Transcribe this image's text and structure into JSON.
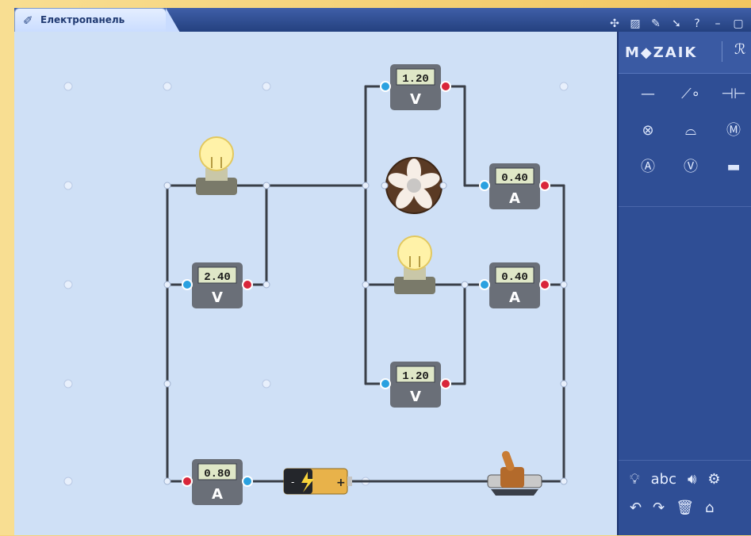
{
  "window": {
    "title": "Електропанель",
    "toolbar_icons": [
      "share-icon",
      "gallery-icon",
      "pen-icon",
      "pointer-icon",
      "help-icon",
      "minimize-icon",
      "maximize-icon"
    ]
  },
  "sidebar": {
    "logo": "M◆ZAIK",
    "components": [
      "wire-icon",
      "switch-icon",
      "battery-icon",
      "lamp-icon",
      "bell-icon",
      "motor-icon",
      "ammeter-icon",
      "voltmeter-icon",
      "resistor-icon"
    ],
    "bottom_row1": [
      "bulb-tool-icon",
      "abc",
      "sound-icon",
      "settings-icon"
    ],
    "bottom_row2": [
      "undo-icon",
      "redo-icon",
      "trash-icon",
      "home-icon"
    ]
  },
  "meters": {
    "v_top": {
      "value": "1.20",
      "unit": "V"
    },
    "a_fan": {
      "value": "0.40",
      "unit": "A"
    },
    "v_left": {
      "value": "2.40",
      "unit": "V"
    },
    "a_lamp": {
      "value": "0.40",
      "unit": "A"
    },
    "v_bottom": {
      "value": "1.20",
      "unit": "V"
    },
    "a_main": {
      "value": "0.80",
      "unit": "A"
    }
  },
  "battery": {
    "minus": "-",
    "plus": "+"
  }
}
